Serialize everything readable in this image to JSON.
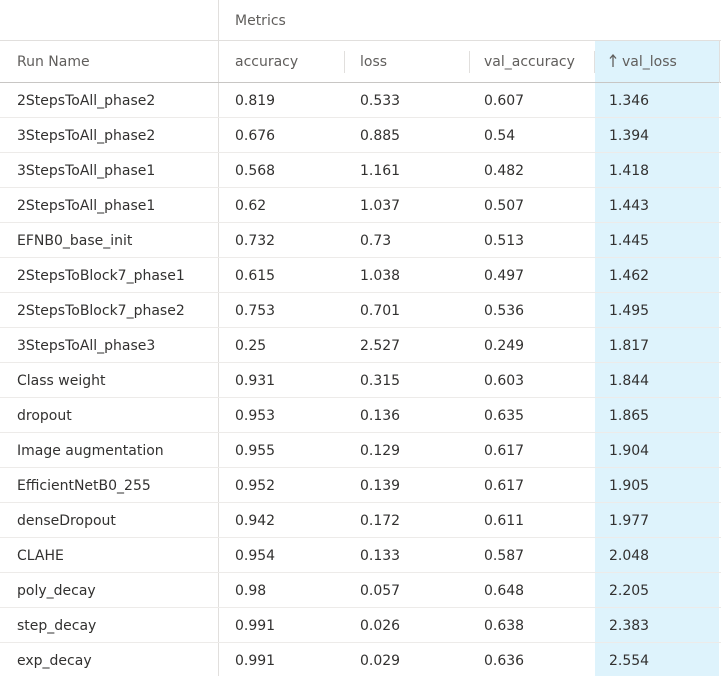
{
  "group_header": {
    "label": "Metrics"
  },
  "columns": {
    "run_name": "Run Name",
    "accuracy": "accuracy",
    "loss": "loss",
    "val_accuracy": "val_accuracy",
    "val_loss": "val_loss"
  },
  "sort": {
    "column": "val_loss",
    "direction": "ascending",
    "icon": "arrow-up-icon"
  },
  "colors": {
    "sorted_column_bg": "#def3fc",
    "header_text": "#605e5c",
    "cell_text": "#323130"
  },
  "rows": [
    {
      "name": "2StepsToAll_phase2",
      "accuracy": "0.819",
      "loss": "0.533",
      "val_accuracy": "0.607",
      "val_loss": "1.346"
    },
    {
      "name": "3StepsToAll_phase2",
      "accuracy": "0.676",
      "loss": "0.885",
      "val_accuracy": "0.54",
      "val_loss": "1.394"
    },
    {
      "name": "3StepsToAll_phase1",
      "accuracy": "0.568",
      "loss": "1.161",
      "val_accuracy": "0.482",
      "val_loss": "1.418"
    },
    {
      "name": "2StepsToAll_phase1",
      "accuracy": "0.62",
      "loss": "1.037",
      "val_accuracy": "0.507",
      "val_loss": "1.443"
    },
    {
      "name": "EFNB0_base_init",
      "accuracy": "0.732",
      "loss": "0.73",
      "val_accuracy": "0.513",
      "val_loss": "1.445"
    },
    {
      "name": "2StepsToBlock7_phase1",
      "accuracy": "0.615",
      "loss": "1.038",
      "val_accuracy": "0.497",
      "val_loss": "1.462"
    },
    {
      "name": "2StepsToBlock7_phase2",
      "accuracy": "0.753",
      "loss": "0.701",
      "val_accuracy": "0.536",
      "val_loss": "1.495"
    },
    {
      "name": "3StepsToAll_phase3",
      "accuracy": "0.25",
      "loss": "2.527",
      "val_accuracy": "0.249",
      "val_loss": "1.817"
    },
    {
      "name": "Class weight",
      "accuracy": "0.931",
      "loss": "0.315",
      "val_accuracy": "0.603",
      "val_loss": "1.844"
    },
    {
      "name": "dropout",
      "accuracy": "0.953",
      "loss": "0.136",
      "val_accuracy": "0.635",
      "val_loss": "1.865"
    },
    {
      "name": "Image augmentation",
      "accuracy": "0.955",
      "loss": "0.129",
      "val_accuracy": "0.617",
      "val_loss": "1.904"
    },
    {
      "name": "EfficientNetB0_255",
      "accuracy": "0.952",
      "loss": "0.139",
      "val_accuracy": "0.617",
      "val_loss": "1.905"
    },
    {
      "name": "denseDropout",
      "accuracy": "0.942",
      "loss": "0.172",
      "val_accuracy": "0.611",
      "val_loss": "1.977"
    },
    {
      "name": "CLAHE",
      "accuracy": "0.954",
      "loss": "0.133",
      "val_accuracy": "0.587",
      "val_loss": "2.048"
    },
    {
      "name": "poly_decay",
      "accuracy": "0.98",
      "loss": "0.057",
      "val_accuracy": "0.648",
      "val_loss": "2.205"
    },
    {
      "name": "step_decay",
      "accuracy": "0.991",
      "loss": "0.026",
      "val_accuracy": "0.638",
      "val_loss": "2.383"
    },
    {
      "name": "exp_decay",
      "accuracy": "0.991",
      "loss": "0.029",
      "val_accuracy": "0.636",
      "val_loss": "2.554"
    }
  ]
}
